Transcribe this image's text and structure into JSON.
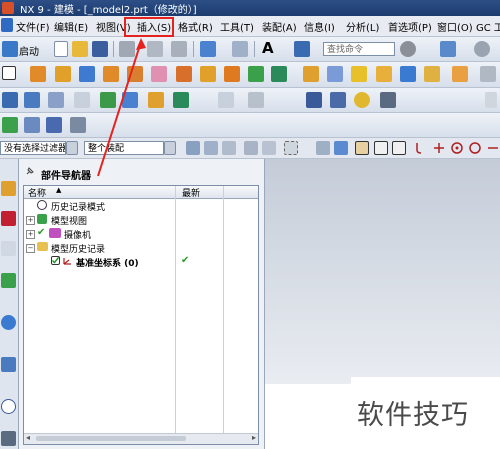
{
  "window": {
    "title": "NX 9 - 建模 - [_model2.prt（修改的）]"
  },
  "menu": [
    {
      "label": "文件(F)"
    },
    {
      "label": "编辑(E)"
    },
    {
      "label": "视图(V)"
    },
    {
      "label": "插入(S)"
    },
    {
      "label": "格式(R)"
    },
    {
      "label": "工具(T)"
    },
    {
      "label": "装配(A)"
    },
    {
      "label": "信息(I)"
    },
    {
      "label": "分析(L)"
    },
    {
      "label": "首选项(P)"
    },
    {
      "label": "窗口(O)"
    },
    {
      "label": "GC 工具"
    }
  ],
  "highlighted_menu": "插入(S)",
  "toolbar": {
    "start_label": "启动",
    "search_placeholder": "查找命令",
    "filter_dropdown": "没有选择过滤器",
    "assembly_dropdown": "整个装配"
  },
  "navigator": {
    "title": "部件导航器",
    "columns": {
      "name": "名称",
      "latest": "最新"
    },
    "rows": [
      {
        "label": "历史记录模式",
        "latest": ""
      },
      {
        "label": "模型视图",
        "latest": ""
      },
      {
        "label": "摄像机",
        "latest": ""
      },
      {
        "label": "模型历史记录",
        "latest": ""
      },
      {
        "label": "基准坐标系 (0)",
        "latest": "✔"
      }
    ]
  },
  "watermark": "软件技巧",
  "colors": {
    "highlight": "#e5221e",
    "title_bar": "#1c3c70",
    "check": "#2a9a2a"
  }
}
